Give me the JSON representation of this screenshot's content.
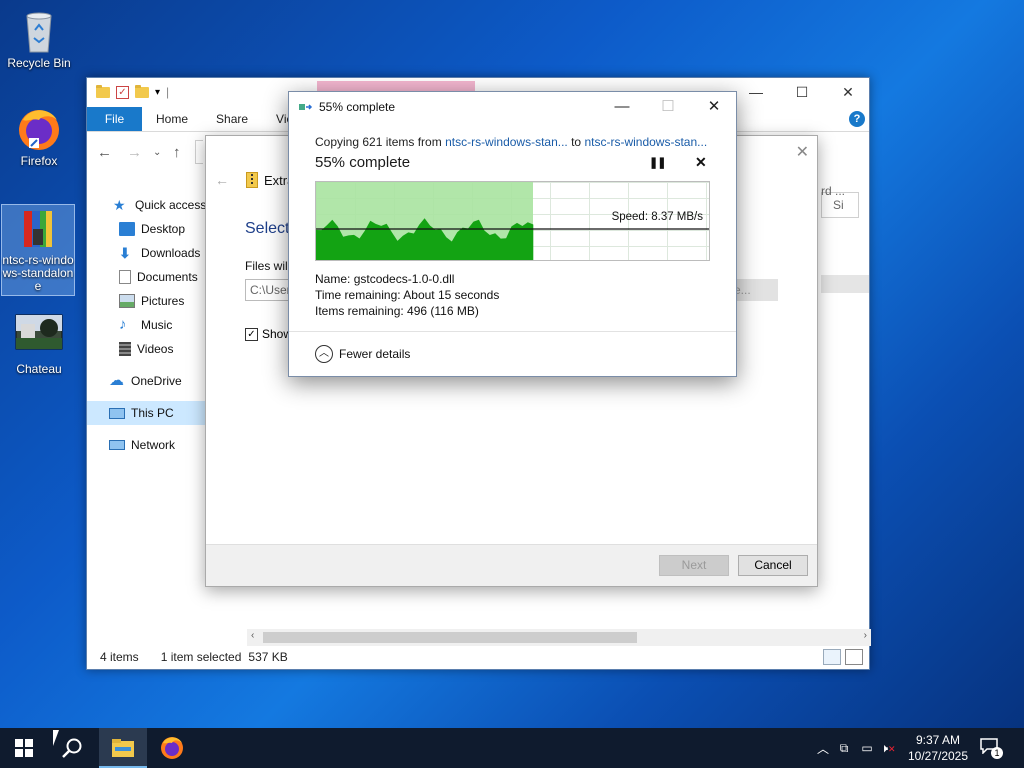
{
  "desktop": {
    "icons": [
      {
        "label": "Recycle Bin"
      },
      {
        "label": "Firefox"
      },
      {
        "label": "ntsc-rs-windows-standalone"
      },
      {
        "label": "Chateau"
      }
    ]
  },
  "explorer": {
    "ribbon_tabs": [
      "File",
      "Home",
      "Share",
      "Vie"
    ],
    "sidebar": [
      {
        "label": "Quick access"
      },
      {
        "label": "Desktop"
      },
      {
        "label": "Downloads"
      },
      {
        "label": "Documents"
      },
      {
        "label": "Pictures"
      },
      {
        "label": "Music"
      },
      {
        "label": "Videos"
      },
      {
        "label": "OneDrive"
      },
      {
        "label": "This PC"
      },
      {
        "label": "Network"
      }
    ],
    "column_partial": "rd ...",
    "column_partial2": "Si",
    "status": {
      "items": "4 items",
      "selected": "1 item selected",
      "size": "537 KB"
    }
  },
  "wizard": {
    "title": "Extra",
    "heading": "Select",
    "files_label": "Files will",
    "path_value": "C:\\User",
    "browse_label": "se...",
    "show_label": "Show",
    "next_label": "Next",
    "cancel_label": "Cancel"
  },
  "copy": {
    "title": "55% complete",
    "line_prefix": "Copying 621 items from ",
    "source": "ntsc-rs-windows-stan...",
    "to": " to ",
    "dest": "ntsc-rs-windows-stan...",
    "percent_text": "55% complete",
    "percent": 55,
    "speed": "Speed: 8.37 MB/s",
    "name_label": "Name:",
    "name_value": "gstcodecs-1.0-0.dll",
    "time_label": "Time remaining:",
    "time_value": "About 15 seconds",
    "items_label": "Items remaining:",
    "items_value": "496 (116 MB)",
    "fewer_details": "Fewer details"
  },
  "taskbar": {
    "time": "9:37 AM",
    "date": "10/27/2025",
    "notification_count": "1"
  },
  "colors": {
    "accent": "#1979ca",
    "progress_fill": "#a8e3a0",
    "graph_fill": "#13a313"
  }
}
